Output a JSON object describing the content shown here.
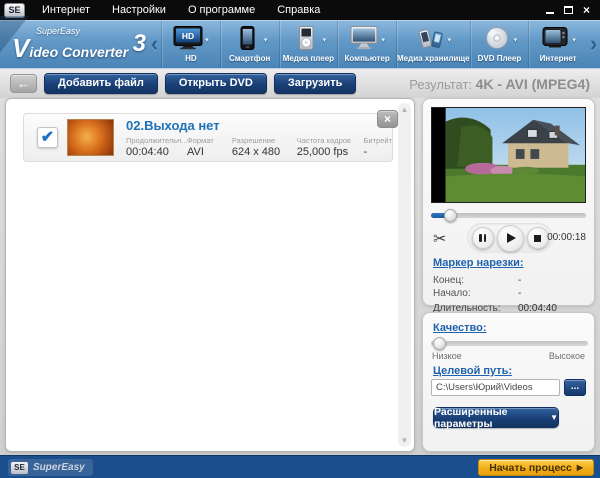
{
  "colors": {
    "accent_blue": "#1f62ae",
    "button_blue": "#1a3f75",
    "toolbar_blue": "#5890c0",
    "footer_blue": "#1b4e8c",
    "start_yellow": "#f2ac17",
    "title_blue": "#1e73b8"
  },
  "icons": {
    "se": "SE",
    "close": "×",
    "check": "✔",
    "back": "←",
    "chevron_left": "‹",
    "chevron_right": "›",
    "caret_down": "▾",
    "dropdown": "▼",
    "scissors": "✂",
    "up_arrow": "▲",
    "down_arrow": "▼",
    "start_arrow": "▶"
  },
  "menubar": {
    "items": [
      "Интернет",
      "Настройки",
      "О программе",
      "Справка"
    ]
  },
  "logo": {
    "brand": "SuperEasy",
    "product": "Video Converter",
    "version": "3"
  },
  "toolbar": {
    "items": [
      {
        "label": "HD",
        "icon": "hd-tv"
      },
      {
        "label": "Смартфон",
        "icon": "smartphone"
      },
      {
        "label": "Медиа плеер",
        "icon": "media-player"
      },
      {
        "label": "Компьютер",
        "icon": "computer"
      },
      {
        "label": "Медиа хранилище",
        "icon": "media-storage"
      },
      {
        "label": "DVD Плеер",
        "icon": "dvd-disc"
      },
      {
        "label": "Интернет",
        "icon": "internet-tv"
      }
    ]
  },
  "actionbar": {
    "add_file": "Добавить файл",
    "open_dvd": "Открыть DVD",
    "download": "Загрузить",
    "result_label": "Результат:",
    "result_value": "4K - AVI (MPEG4)"
  },
  "file_list": {
    "rows": [
      {
        "checked": true,
        "title": "02.Выхода нет",
        "duration_label": "Продолжительн...",
        "duration": "00:04:40",
        "format_label": "Формат",
        "format": "AVI",
        "resolution_label": "Разрешение",
        "resolution": "624 x 480",
        "framerate_label": "Частота кадров",
        "framerate": "25,000 fps",
        "bitrate_label": "Битрейт",
        "bitrate": "-"
      }
    ]
  },
  "player": {
    "current_time": "00:00:18"
  },
  "marker": {
    "title": "Маркер нарезки:",
    "end_label": "Конец:",
    "end_value": "-",
    "start_label": "Начало:",
    "start_value": "-",
    "duration_label": "Длительность:",
    "duration_value": "00:04:40"
  },
  "output": {
    "quality_label": "Качество:",
    "quality_low": "Низкое",
    "quality_high": "Высокое",
    "path_label": "Целевой путь:",
    "path_value": "C:\\Users\\Юрий\\Videos",
    "browse_label": "...",
    "advanced_label": "Расширенные параметры"
  },
  "footer": {
    "brand": "SuperEasy",
    "start_label": "Начать процесс"
  }
}
